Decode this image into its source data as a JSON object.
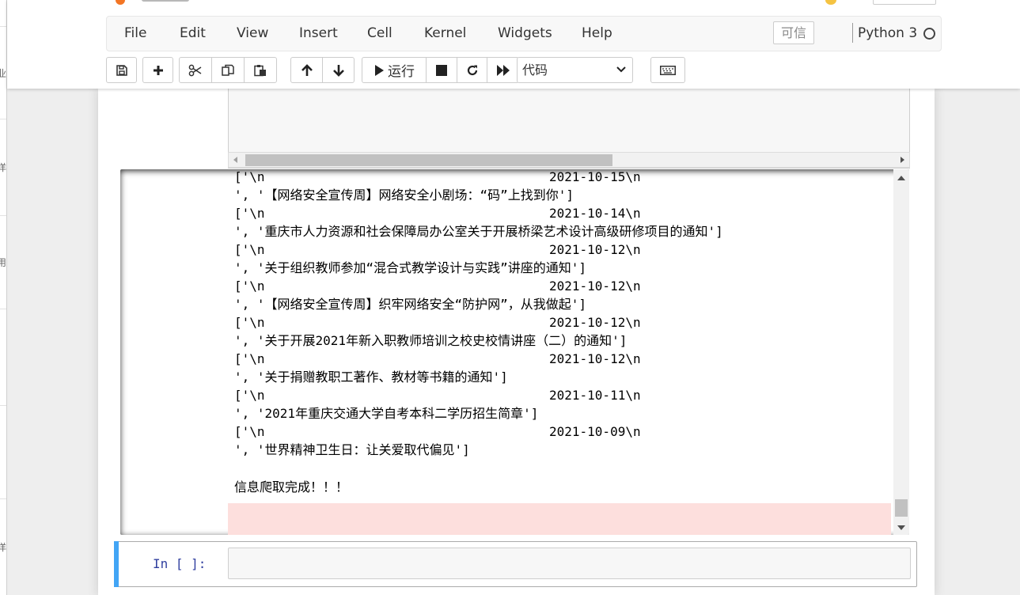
{
  "window_bg": "#eeeeee",
  "accent_color": "#42a5f5",
  "error_bg_color": "#fddfdd",
  "prompt_color": "#303f9f",
  "menu": {
    "items": [
      "File",
      "Edit",
      "View",
      "Insert",
      "Cell",
      "Kernel",
      "Widgets",
      "Help"
    ],
    "trusted": "可信",
    "kernel_name": "Python 3"
  },
  "toolbar": {
    "run_label": "运行",
    "cell_type": "代码",
    "icons": [
      "save-icon",
      "plus-icon",
      "scissors-icon",
      "copy-icon",
      "paste-icon",
      "arrow-up-icon",
      "arrow-down-icon",
      "play-icon",
      "stop-icon",
      "restart-icon",
      "fast-forward-icon",
      "chevron-down-icon",
      "keyboard-icon"
    ]
  },
  "output": {
    "rows": [
      {
        "left": "['\\n",
        "date": "2021-10-15\\n"
      },
      {
        "left": "', '【网络安全宣传周】网络安全小剧场：“码”上找到你']",
        "date": ""
      },
      {
        "left": "['\\n",
        "date": "2021-10-14\\n"
      },
      {
        "left": "', '重庆市人力资源和社会保障局办公室关于开展桥梁艺术设计高级研修项目的通知']",
        "date": ""
      },
      {
        "left": "['\\n",
        "date": "2021-10-12\\n"
      },
      {
        "left": "', '关于组织教师参加“混合式教学设计与实践”讲座的通知']",
        "date": ""
      },
      {
        "left": "['\\n",
        "date": "2021-10-12\\n"
      },
      {
        "left": "', '【网络安全宣传周】织牢网络安全“防护网”，从我做起']",
        "date": ""
      },
      {
        "left": "['\\n",
        "date": "2021-10-12\\n"
      },
      {
        "left": "', '关于开展2021年新入职教师培训之校史校情讲座（二）的通知']",
        "date": ""
      },
      {
        "left": "['\\n",
        "date": "2021-10-12\\n"
      },
      {
        "left": "', '关于捐赠教职工著作、教材等书籍的通知']",
        "date": ""
      },
      {
        "left": "['\\n",
        "date": "2021-10-11\\n"
      },
      {
        "left": "', '2021年重庆交通大学自考本科二学历招生简章']",
        "date": ""
      },
      {
        "left": "['\\n",
        "date": "2021-10-09\\n"
      },
      {
        "left": "', '世界精神卫生日：让关爱取代偏见']",
        "date": ""
      }
    ],
    "final_message": "信息爬取完成！！！"
  },
  "input_cell": {
    "prompt": "In [ ]:",
    "code": ""
  },
  "background_window": {
    "fragments": [
      "业",
      "洋",
      "用",
      "洋"
    ]
  }
}
